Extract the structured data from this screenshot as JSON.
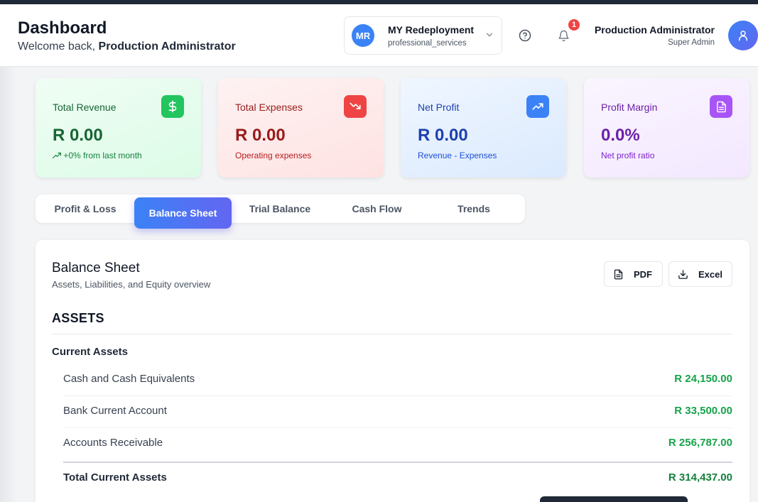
{
  "header": {
    "title": "Dashboard",
    "welcome_prefix": "Welcome back,",
    "welcome_name": "Production Administrator"
  },
  "company": {
    "initials": "MR",
    "name": "MY Redeployment",
    "type": "professional_services"
  },
  "notifications": {
    "count": "1"
  },
  "user": {
    "name": "Production Administrator",
    "role": "Super Admin"
  },
  "stats": [
    {
      "label": "Total Revenue",
      "value": "R 0.00",
      "note": "+0% from last month",
      "icon": "dollar-icon",
      "color": "#22c55e"
    },
    {
      "label": "Total Expenses",
      "value": "R 0.00",
      "note": "Operating expenses",
      "icon": "trending-down-icon",
      "color": "#ef4444"
    },
    {
      "label": "Net Profit",
      "value": "R 0.00",
      "note": "Revenue - Expenses",
      "icon": "trending-up-icon",
      "color": "#3b82f6"
    },
    {
      "label": "Profit Margin",
      "value": "0.0%",
      "note": "Net profit ratio",
      "icon": "document-icon",
      "color": "#a855f7"
    }
  ],
  "tabs": [
    {
      "label": "Profit & Loss",
      "active": false
    },
    {
      "label": "Balance Sheet",
      "active": true
    },
    {
      "label": "Trial Balance",
      "active": false
    },
    {
      "label": "Cash Flow",
      "active": false
    },
    {
      "label": "Trends",
      "active": false
    }
  ],
  "report": {
    "title": "Balance Sheet",
    "subtitle": "Assets, Liabilities, and Equity overview",
    "pdf_label": "PDF",
    "excel_label": "Excel",
    "section": "ASSETS",
    "group": "Current Assets",
    "rows": [
      {
        "label": "Cash and Cash Equivalents",
        "value": "R 24,150.00"
      },
      {
        "label": "Bank Current Account",
        "value": "R 33,500.00"
      },
      {
        "label": "Accounts Receivable",
        "value": "R 256,787.00"
      }
    ],
    "total": {
      "label": "Total Current Assets",
      "value": "R 314,437.00"
    }
  }
}
